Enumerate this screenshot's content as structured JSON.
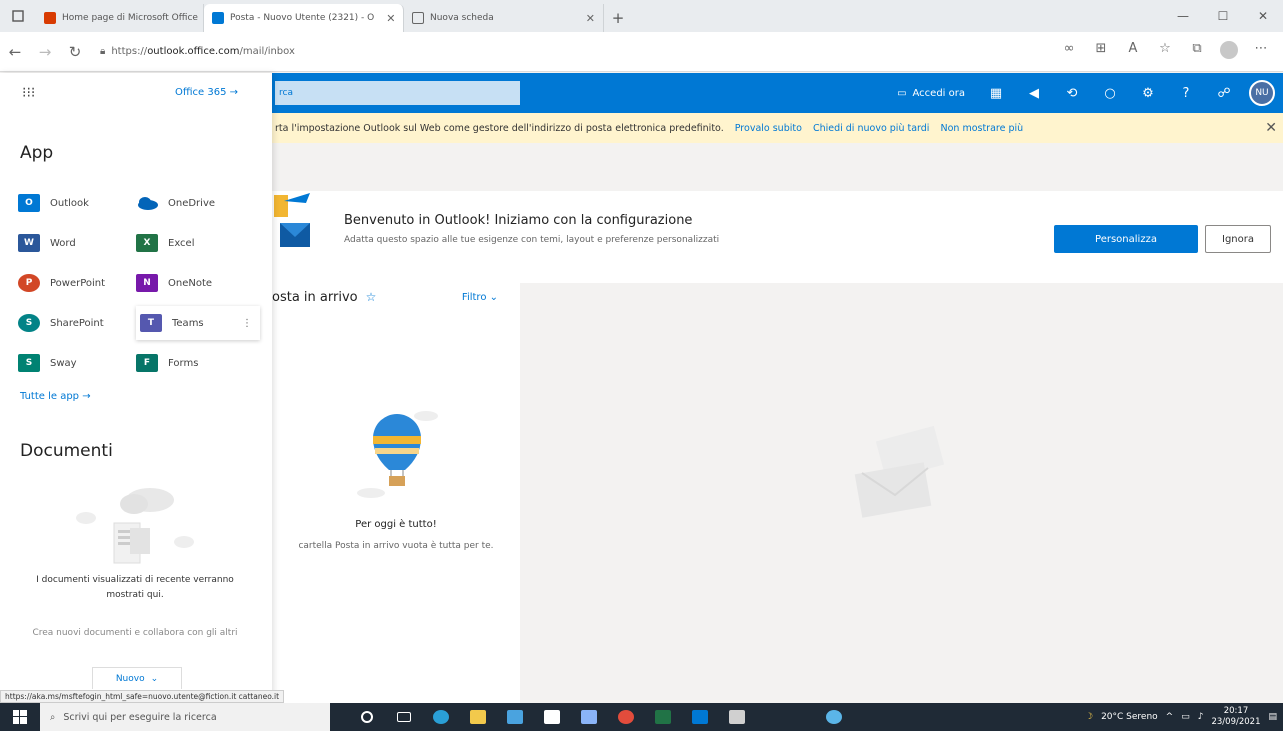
{
  "browser": {
    "tabs": [
      {
        "title": "Home page di Microsoft Office",
        "color": "#d83b01",
        "active": false
      },
      {
        "title": "Posta - Nuovo Utente (2321) - O",
        "color": "#0078d4",
        "active": true
      },
      {
        "title": "Nuova scheda",
        "color": "#666666",
        "active": false
      }
    ],
    "url_prefix": "https://",
    "url_domain": "outlook.office.com",
    "url_path": "/mail/inbox"
  },
  "header": {
    "office_label": "Office 365",
    "search_text": "rca",
    "meet_label": "Accedi ora",
    "avatar_initials": "NU"
  },
  "infobar": {
    "message": "rta l'impostazione Outlook sul Web come gestore dell'indirizzo di posta elettronica predefinito.",
    "links": [
      "Provalo subito",
      "Chiedi di nuovo più tardi",
      "Non mostrare più"
    ]
  },
  "launcher": {
    "app_heading": "App",
    "apps": [
      {
        "label": "Outlook",
        "color": "#0078d4",
        "letter": "O"
      },
      {
        "label": "OneDrive",
        "color": "#0364b8",
        "letter": ""
      },
      {
        "label": "Word",
        "color": "#2b579a",
        "letter": "W"
      },
      {
        "label": "Excel",
        "color": "#217346",
        "letter": "X"
      },
      {
        "label": "PowerPoint",
        "color": "#d24726",
        "letter": "P"
      },
      {
        "label": "OneNote",
        "color": "#7719aa",
        "letter": "N"
      },
      {
        "label": "SharePoint",
        "color": "#038387",
        "letter": "S"
      },
      {
        "label": "Teams",
        "color": "#5558af",
        "letter": "T"
      },
      {
        "label": "Sway",
        "color": "#008272",
        "letter": "S"
      },
      {
        "label": "Forms",
        "color": "#077568",
        "letter": "F"
      }
    ],
    "all_apps": "Tutte le app",
    "docs_heading": "Documenti",
    "docs_text": "I documenti visualizzati di recente verranno mostrati qui.",
    "docs_sub": "Crea nuovi documenti e collabora con gli altri",
    "new_label": "Nuovo"
  },
  "welcome": {
    "title": "Benvenuto in Outlook! Iniziamo con la configurazione",
    "subtitle": "Adatta questo spazio alle tue esigenze con temi, layout e preferenze personalizzati",
    "primary_button": "Personalizza",
    "secondary_button": "Ignora"
  },
  "list": {
    "folder": "osta in arrivo",
    "filter": "Filtro",
    "empty_title": "Per oggi è tutto!",
    "empty_desc": "cartella Posta in arrivo vuota è tutta per te."
  },
  "status_url": "https://aka.ms/msftefogin_html_safe=nuovo.utente@fiction.it cattaneo.it",
  "taskbar": {
    "search_placeholder": "Scrivi qui per eseguire la ricerca",
    "weather": "20°C Sereno",
    "time": "20:17",
    "date": "23/09/2021"
  }
}
